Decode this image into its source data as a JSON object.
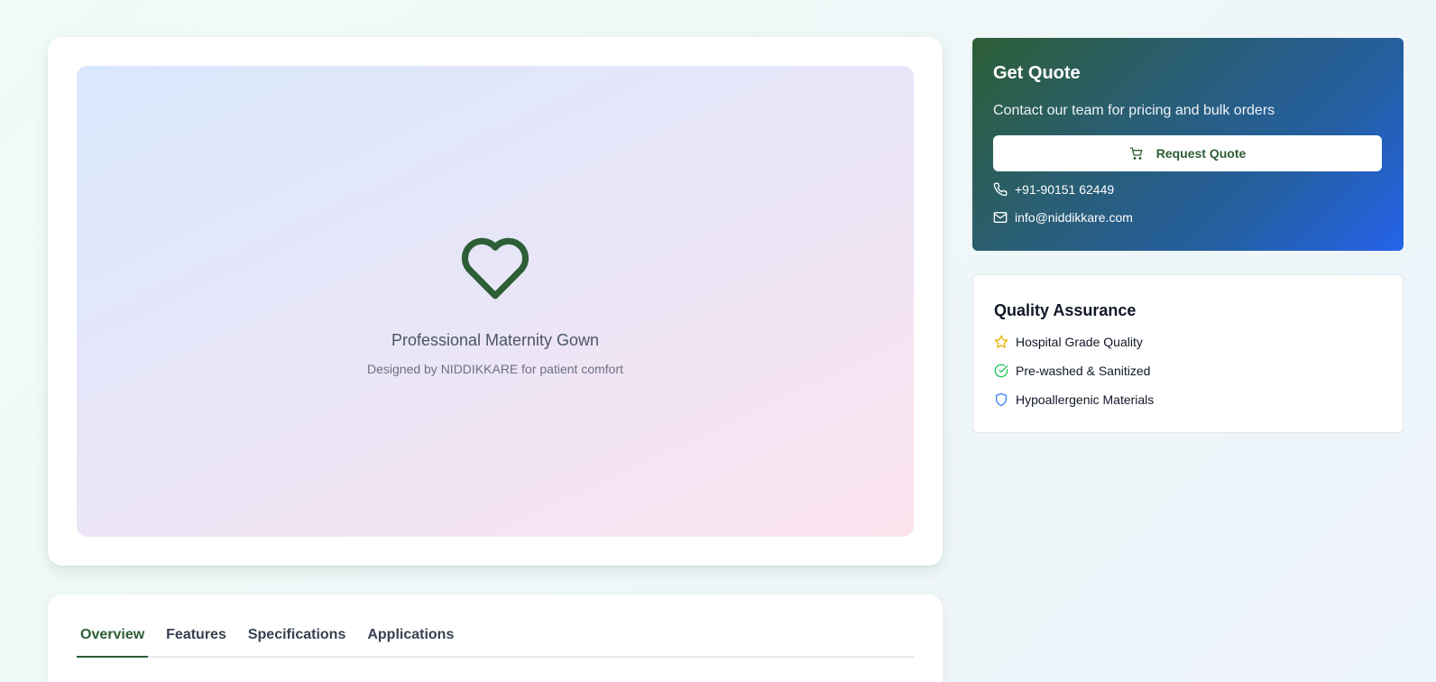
{
  "hero": {
    "icon": "heart-icon",
    "title": "Professional Maternity Gown",
    "subtitle": "Designed by NIDDIKKARE for patient comfort",
    "icon_color": "#2d5e35"
  },
  "tabs": [
    {
      "label": "Overview",
      "active": true
    },
    {
      "label": "Features",
      "active": false
    },
    {
      "label": "Specifications",
      "active": false
    },
    {
      "label": "Applications",
      "active": false
    }
  ],
  "quote": {
    "title": "Get Quote",
    "subtitle": "Contact our team for pricing and bulk orders",
    "button_label": "Request Quote",
    "button_icon": "cart-icon",
    "phone": "+91-90151 62449",
    "phone_icon": "phone-icon",
    "email": "info@niddikkare.com",
    "email_icon": "mail-icon",
    "gradient": [
      "#2d5e35",
      "#2563eb"
    ]
  },
  "quality": {
    "title": "Quality Assurance",
    "items": [
      {
        "label": "Hospital Grade Quality",
        "icon": "star-icon",
        "color": "#eab308"
      },
      {
        "label": "Pre-washed & Sanitized",
        "icon": "check-circle-icon",
        "color": "#22c55e"
      },
      {
        "label": "Hypoallergenic Materials",
        "icon": "shield-icon",
        "color": "#3b82f6"
      }
    ]
  }
}
